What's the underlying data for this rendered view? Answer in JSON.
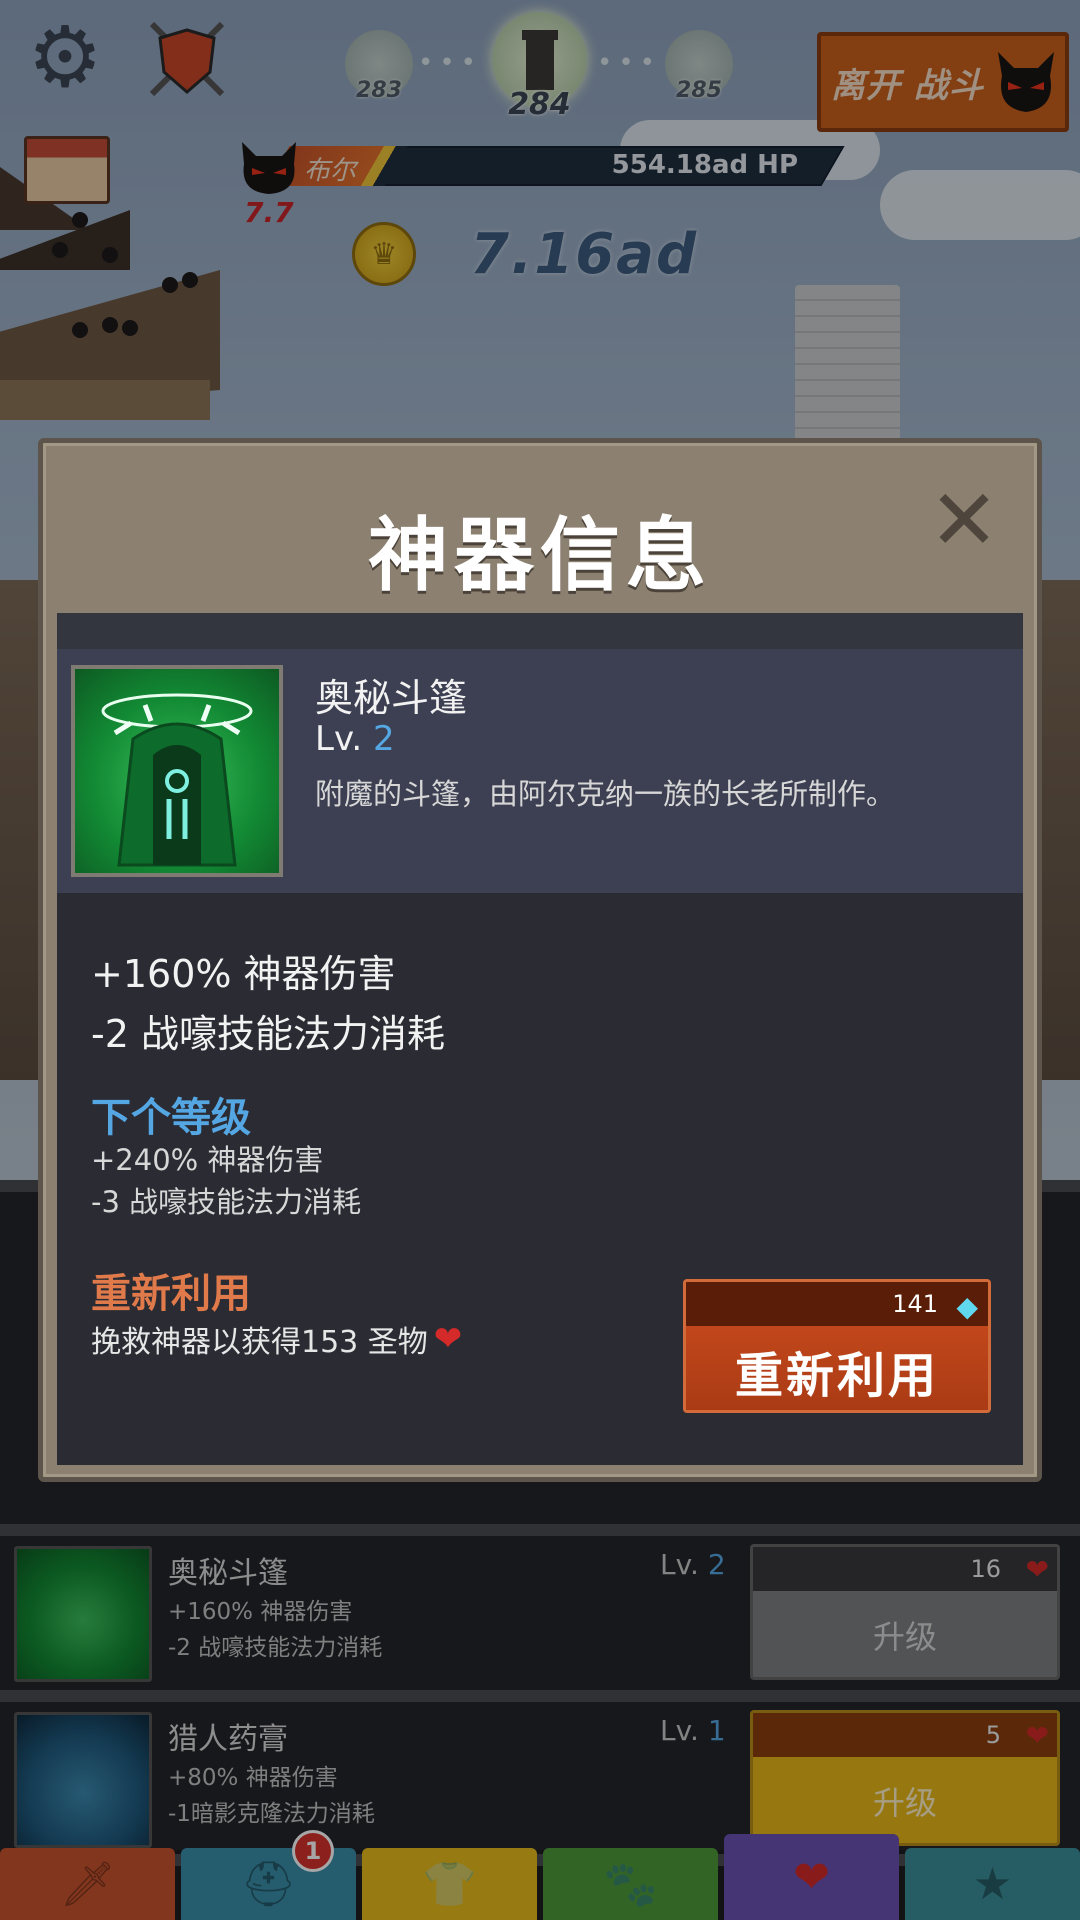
{
  "hud": {
    "settings_icon": "gear-icon",
    "clan_icon": "shield-icon",
    "stages": {
      "prev": "283",
      "current": "284",
      "next": "285"
    },
    "leave_button_label": "离开 战斗",
    "boss_name": "布尔",
    "boss_hp": "554.18ad HP",
    "boss_timer": "7.7",
    "gold": "7.16ad"
  },
  "modal": {
    "title": "神器信息",
    "close_icon": "close-icon",
    "artifact": {
      "name": "奥秘斗篷",
      "level_prefix": "Lv.",
      "level": "2",
      "description": "附魔的斗篷，由阿尔克纳一族的长老所制作。"
    },
    "current_stats": [
      "+160% 神器伤害",
      "-2 战嚎技能法力消耗"
    ],
    "next_level": {
      "title": "下个等级",
      "stats": [
        "+240% 神器伤害",
        "-3 战嚎技能法力消耗"
      ]
    },
    "recycle": {
      "title": "重新利用",
      "description": "挽救神器以获得153 圣物",
      "button_cost": "141",
      "button_label": "重新利用"
    }
  },
  "artifact_list": [
    {
      "name": "奥秘斗篷",
      "level_prefix": "Lv.",
      "level": "2",
      "stat1": "+160% 神器伤害",
      "stat2": "-2 战嚎技能法力消耗",
      "cost": "16",
      "button_label": "升级",
      "button_style": "gray"
    },
    {
      "name": "猎人药膏",
      "level_prefix": "Lv.",
      "level": "1",
      "stat1": "+80% 神器伤害",
      "stat2": "-1暗影克隆法力消耗",
      "cost": "5",
      "button_label": "升级",
      "button_style": "yellow"
    }
  ],
  "tabs": [
    {
      "icon": "sword-icon",
      "color": "#c8532e"
    },
    {
      "icon": "viking-helmet-icon",
      "color": "#3b8faa",
      "badge": "1"
    },
    {
      "icon": "shirt-icon",
      "color": "#e8bd1d"
    },
    {
      "icon": "pet-icon",
      "color": "#4e9a3a"
    },
    {
      "icon": "winged-heart-icon",
      "color": "#6a52b2"
    },
    {
      "icon": "star-icon",
      "color": "#3b8f9a"
    }
  ]
}
